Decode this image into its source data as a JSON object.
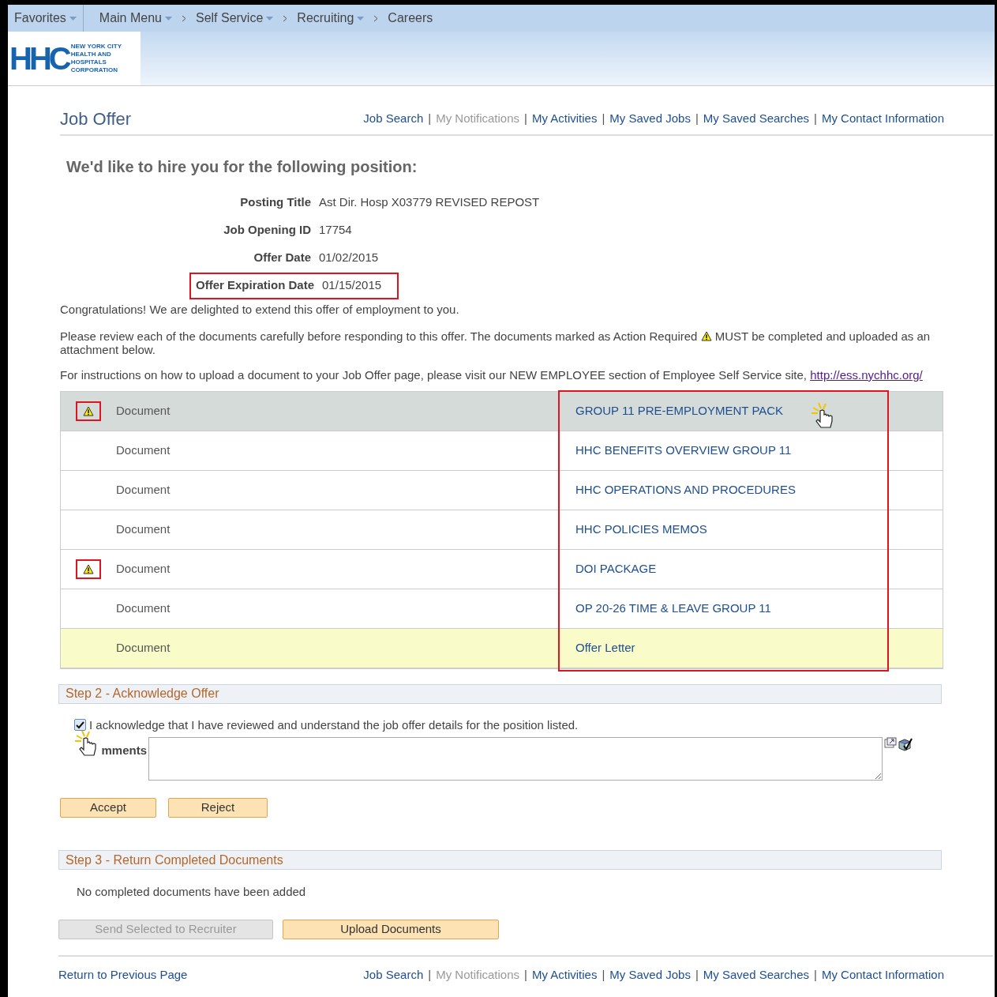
{
  "breadcrumb": {
    "favorites": "Favorites",
    "items": [
      {
        "label": "Main Menu",
        "dropdown": true
      },
      {
        "label": "Self Service",
        "dropdown": true
      },
      {
        "label": "Recruiting",
        "dropdown": true
      },
      {
        "label": "Careers",
        "dropdown": false
      }
    ]
  },
  "logo": {
    "mark": "HHC",
    "lines": [
      "NEW YORK CITY",
      "HEALTH AND",
      "HOSPITALS",
      "CORPORATION"
    ]
  },
  "page_title": "Job Offer",
  "link_separator": "|",
  "top_links": [
    {
      "label": "Job Search",
      "disabled": false
    },
    {
      "label": "My Notifications",
      "disabled": true
    },
    {
      "label": "My Activities",
      "disabled": false
    },
    {
      "label": "My Saved Jobs",
      "disabled": false
    },
    {
      "label": "My Saved Searches",
      "disabled": false
    },
    {
      "label": "My Contact Information",
      "disabled": false
    }
  ],
  "heading": "We'd like to hire you for the following position:",
  "fields": [
    {
      "label": "Posting Title",
      "value": "Ast Dir. Hosp X03779 REVISED REPOST",
      "outlined": false
    },
    {
      "label": "Job Opening ID",
      "value": "17754",
      "outlined": false
    },
    {
      "label": "Offer Date",
      "value": "01/02/2015",
      "outlined": false
    },
    {
      "label": "Offer Expiration Date",
      "value": "01/15/2015",
      "outlined": true
    }
  ],
  "congrats": "Congratulations! We are delighted to extend this offer of employment to you.",
  "review_text_before": "Please review each of the documents carefully before responding to this offer. The documents marked as Action Required",
  "review_text_after": "MUST be completed and uploaded as an attachment below.",
  "instructions": "For instructions on how to upload a document to your Job Offer page, please visit our NEW EMPLOYEE section of Employee Self Service site,",
  "instructions_link": "http://ess.nychhc.org/",
  "documents": [
    {
      "type": "Document",
      "name": "GROUP 11 PRE-EMPLOYMENT PACK",
      "action_required": true,
      "highlighted": true,
      "current": false
    },
    {
      "type": "Document",
      "name": "HHC BENEFITS OVERVIEW GROUP 11",
      "action_required": false,
      "highlighted": false,
      "current": false
    },
    {
      "type": "Document",
      "name": "HHC OPERATIONS AND PROCEDURES",
      "action_required": false,
      "highlighted": false,
      "current": false
    },
    {
      "type": "Document",
      "name": "HHC POLICIES MEMOS",
      "action_required": false,
      "highlighted": false,
      "current": false
    },
    {
      "type": "Document",
      "name": "DOI PACKAGE",
      "action_required": true,
      "highlighted": false,
      "current": false
    },
    {
      "type": "Document",
      "name": "OP 20-26 TIME & LEAVE GROUP 11",
      "action_required": false,
      "highlighted": false,
      "current": false
    },
    {
      "type": "Document",
      "name": "Offer Letter",
      "action_required": false,
      "highlighted": false,
      "current": true
    }
  ],
  "step2": {
    "title": "Step 2 - Acknowledge Offer",
    "acknowledge": {
      "label": "I acknowledge that I have reviewed and understand the job offer details for the position listed.",
      "checked": true
    },
    "comments_label": "mments",
    "buttons": [
      {
        "label": "Accept",
        "disabled": false
      },
      {
        "label": "Reject",
        "disabled": false
      }
    ]
  },
  "step3": {
    "title": "Step 3 - Return Completed Documents",
    "message": "No completed documents have been added",
    "buttons": [
      {
        "label": "Send Selected to Recruiter",
        "disabled": true
      },
      {
        "label": "Upload Documents",
        "disabled": false
      }
    ]
  },
  "footer": {
    "return_link": "Return to Previous Page",
    "links": [
      {
        "label": "Job Search",
        "disabled": false
      },
      {
        "label": "My Notifications",
        "disabled": true
      },
      {
        "label": "My Activities",
        "disabled": false
      },
      {
        "label": "My Saved Jobs",
        "disabled": false
      },
      {
        "label": "My Saved Searches",
        "disabled": false
      },
      {
        "label": "My Contact Information",
        "disabled": false
      }
    ]
  }
}
